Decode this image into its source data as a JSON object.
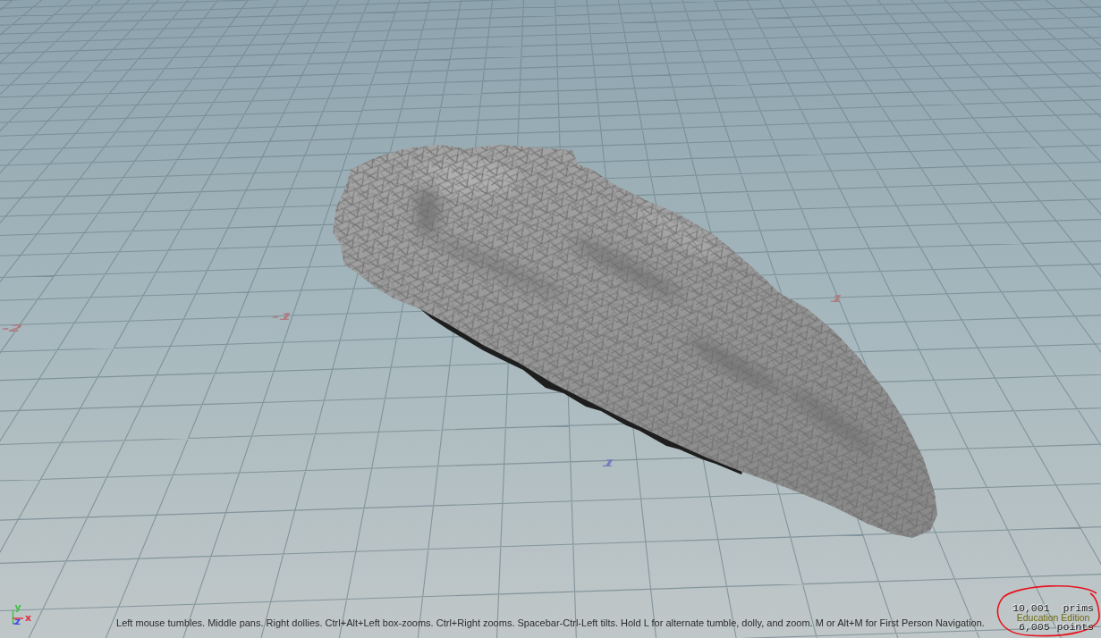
{
  "viewport": {
    "grid_labels": [
      {
        "text": "-2",
        "color": "#b07a7e"
      },
      {
        "text": "-1",
        "color": "#b07a7e"
      },
      {
        "text": "1",
        "color": "#b07a7e"
      },
      {
        "text": "1",
        "color": "#737cbc"
      }
    ],
    "axis_gizmo": {
      "labels": [
        {
          "text": "y",
          "color": "#3cc43c"
        },
        {
          "text": "z",
          "color": "#3a4ee0"
        },
        {
          "text": "x",
          "color": "#e8283a"
        }
      ]
    },
    "hint": "Left mouse tumbles. Middle pans. Right dollies. Ctrl+Alt+Left box-zooms. Ctrl+Right zooms. Spacebar-Ctrl-Left tilts. Hold L for alternate tumble, dolly, and zoom. M or Alt+M for First Person Navigation.",
    "stats": [
      {
        "value": "10,001",
        "unit": "prims"
      },
      {
        "value": "6,005",
        "unit": "points"
      }
    ],
    "watermark": "Education Edition"
  }
}
